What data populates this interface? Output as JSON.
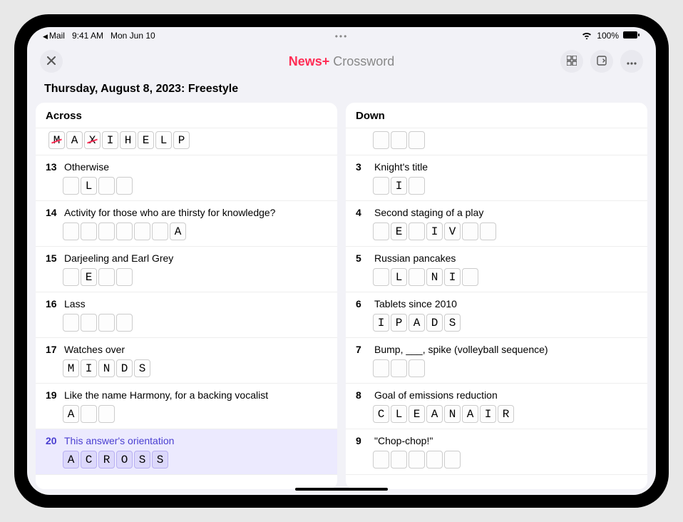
{
  "status": {
    "breadcrumb": "Mail",
    "time": "9:41 AM",
    "date": "Mon Jun 10",
    "battery": "100%"
  },
  "nav": {
    "brand_prefix": "News+",
    "title_suffix": " Crossword"
  },
  "page_title": "Thursday, August 8, 2023: Freestyle",
  "across": {
    "header": "Across",
    "clues": [
      {
        "num": "",
        "text": "",
        "letters": [
          "M",
          "A",
          "X",
          "I",
          "H",
          "E",
          "L",
          "P"
        ],
        "struck": [
          0,
          2
        ],
        "no_clue": true
      },
      {
        "num": "13",
        "text": "Otherwise",
        "letters": [
          "",
          "L",
          "",
          ""
        ]
      },
      {
        "num": "14",
        "text": "Activity for those who are thirsty for knowledge?",
        "letters": [
          "",
          "",
          "",
          "",
          "",
          "",
          "A"
        ]
      },
      {
        "num": "15",
        "text": "Darjeeling and Earl Grey",
        "letters": [
          "",
          "E",
          "",
          ""
        ]
      },
      {
        "num": "16",
        "text": "Lass",
        "letters": [
          "",
          "",
          "",
          ""
        ]
      },
      {
        "num": "17",
        "text": "Watches over",
        "letters": [
          "M",
          "I",
          "N",
          "D",
          "S"
        ]
      },
      {
        "num": "19",
        "text": "Like the name Harmony, for a backing vocalist",
        "letters": [
          "A",
          "",
          ""
        ]
      },
      {
        "num": "20",
        "text": "This answer's orientation",
        "letters": [
          "A",
          "C",
          "R",
          "O",
          "S",
          "S"
        ],
        "selected": true
      }
    ]
  },
  "down": {
    "header": "Down",
    "partial_top": {
      "letters": [
        "",
        "",
        ""
      ]
    },
    "clues": [
      {
        "num": "3",
        "text": "Knight's title",
        "letters": [
          "",
          "I",
          ""
        ]
      },
      {
        "num": "4",
        "text": "Second staging of a play",
        "letters": [
          "",
          "E",
          "",
          "I",
          "V",
          "",
          ""
        ]
      },
      {
        "num": "5",
        "text": "Russian pancakes",
        "letters": [
          "",
          "L",
          "",
          "N",
          "I",
          ""
        ]
      },
      {
        "num": "6",
        "text": "Tablets since 2010",
        "letters": [
          "I",
          "P",
          "A",
          "D",
          "S"
        ]
      },
      {
        "num": "7",
        "text": "Bump, ___, spike (volleyball sequence)",
        "letters": [
          "",
          "",
          ""
        ]
      },
      {
        "num": "8",
        "text": "Goal of emissions reduction",
        "letters": [
          "C",
          "L",
          "E",
          "A",
          "N",
          "A",
          "I",
          "R"
        ]
      },
      {
        "num": "9",
        "text": "\"Chop-chop!\"",
        "letters": [
          "",
          "",
          "",
          "",
          ""
        ]
      }
    ]
  }
}
